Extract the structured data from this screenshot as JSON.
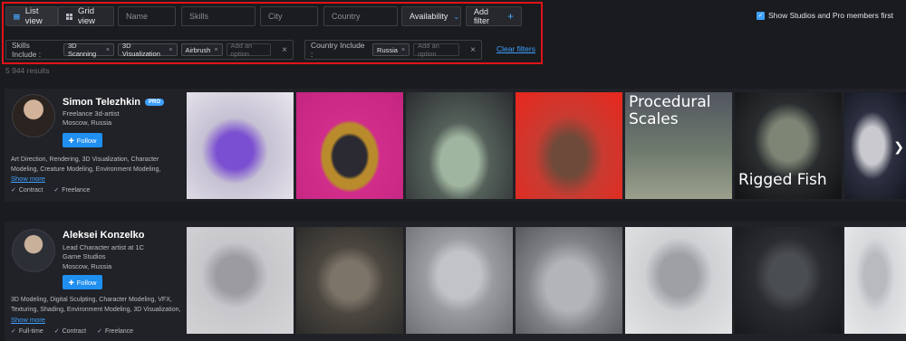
{
  "filters": {
    "list_view_label": "List view",
    "grid_view_label": "Grid view",
    "name_placeholder": "Name",
    "skills_placeholder": "Skills",
    "city_placeholder": "City",
    "country_placeholder": "Country",
    "availability_label": "Availability",
    "add_filter_label": "Add filter",
    "skills_include_label": "Skills Include :",
    "skills_chips": [
      "3D Scanning",
      "3D Visualization",
      "Airbrush"
    ],
    "add_option_placeholder": "Add an option",
    "country_include_label": "Country Include :",
    "country_chips": [
      "Russia"
    ],
    "clear_filters_label": "Clear filters"
  },
  "toggle_label": "Show Studios and Pro members first",
  "results_count": "5 944 results",
  "artists": [
    {
      "name": "Simon Telezhkin",
      "badge": "PRO",
      "role": "Freelance 3d-artist",
      "location": "Moscow, Russia",
      "follow_label": "Follow",
      "skills": "Art Direction, Rendering, 3D Visualization, Character Modeling, Creature Modeling, Environment Modeling,",
      "show_more": "Show more",
      "availability": [
        "Contract",
        "Freelance"
      ],
      "thumbnails": [
        {
          "icon": "purple-sculpture-image",
          "overlay": ""
        },
        {
          "icon": "masked-figure-image",
          "overlay": ""
        },
        {
          "icon": "green-creature-image",
          "overlay": ""
        },
        {
          "icon": "crystal-rock-image",
          "overlay": ""
        },
        {
          "icon": "fish-scales-image",
          "overlay": "Procedural Scales"
        },
        {
          "icon": "fish-rig-image",
          "overlay": "Rigged Fish"
        },
        {
          "icon": "creature-drawing-image",
          "overlay": ""
        }
      ]
    },
    {
      "name": "Aleksei Konzelko",
      "badge": "",
      "role": "Lead Character artist at 1C Game Studios",
      "location": "Moscow, Russia",
      "follow_label": "Follow",
      "skills": "3D Modeling, Digital Sculpting, Character Modeling, VFX, Texturing, Shading, Environment Modeling, 3D Visualization,",
      "show_more": "Show more",
      "availability": [
        "Full-time",
        "Contract",
        "Freelance"
      ],
      "thumbnails": [
        {
          "icon": "horse-model-image",
          "overlay": ""
        },
        {
          "icon": "soldier-models-image",
          "overlay": ""
        },
        {
          "icon": "pilot-figure-image",
          "overlay": ""
        },
        {
          "icon": "tank-tread-image",
          "overlay": ""
        },
        {
          "icon": "soldier-gear-image",
          "overlay": ""
        },
        {
          "icon": "night-vision-soldier-image",
          "overlay": ""
        },
        {
          "icon": "winter-soldier-image",
          "overlay": ""
        }
      ]
    }
  ],
  "colors": {
    "accent": "#3ea0ff",
    "highlight_frame": "#e0131a",
    "background": "#1a1b1e"
  }
}
